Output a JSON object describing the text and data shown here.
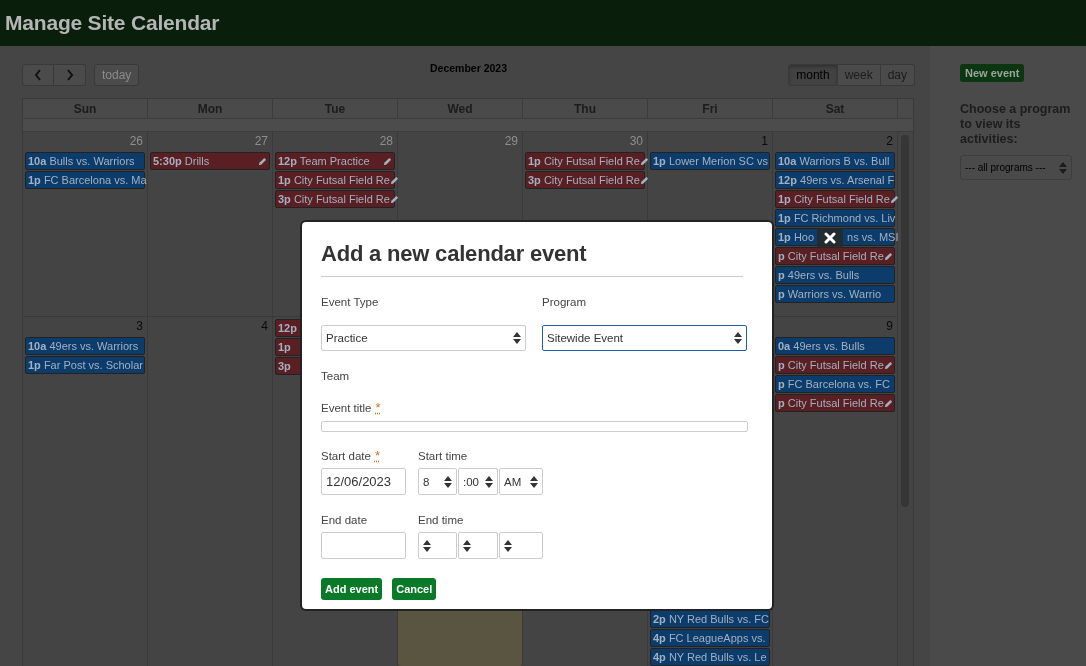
{
  "header": {
    "title": "Manage Site Calendar"
  },
  "toolbar": {
    "today_button": {
      "label": "today",
      "disabled": true
    },
    "title": "December 2023",
    "views": [
      {
        "label": "month",
        "selected": true
      },
      {
        "label": "week",
        "selected": false
      },
      {
        "label": "day",
        "selected": false
      }
    ]
  },
  "calendar": {
    "day_names": [
      "Sun",
      "Mon",
      "Tue",
      "Wed",
      "Thu",
      "Fri",
      "Sat"
    ],
    "weeks": [
      {
        "days": [
          {
            "date": "26",
            "other_month": true,
            "today": false,
            "events": [
              {
                "time": "10a",
                "title": "Bulls vs. Warriors",
                "color": "#0c3c6b",
                "editable": false
              },
              {
                "time": "1p",
                "title": "FC Barcelona vs. Ma",
                "color": "#0c3c6b"
              }
            ]
          },
          {
            "date": "27",
            "other_month": true,
            "today": false,
            "events": [
              {
                "time": "5:30p",
                "title": "Drills",
                "color": "#5a1f23",
                "editable": true
              }
            ]
          },
          {
            "date": "28",
            "other_month": true,
            "today": false,
            "events": [
              {
                "time": "12p",
                "title": "Team Practice",
                "color": "#5a1f23",
                "editable": true
              },
              {
                "time": "1p",
                "title": "City Futsal Field Re",
                "color": "#5a1f23",
                "editable": true
              },
              {
                "time": "3p",
                "title": "City Futsal Field Re",
                "color": "#5a1f23",
                "editable": true
              }
            ]
          },
          {
            "date": "29",
            "other_month": true,
            "today": false
          },
          {
            "date": "30",
            "other_month": true,
            "today": false,
            "events": [
              {
                "time": "1p",
                "title": "City Futsal Field Re",
                "color": "#5a1f23",
                "editable": true
              },
              {
                "time": "3p",
                "title": "City Futsal Field Re",
                "color": "#5a1f23",
                "editable": true
              }
            ]
          },
          {
            "date": "1",
            "other_month": false,
            "today": false,
            "events": [
              {
                "time": "1p",
                "title": "Lower Merion SC vs",
                "color": "#0c3c6b",
                "editable": false
              }
            ]
          },
          {
            "date": "2",
            "other_month": false,
            "today": false,
            "events": [
              {
                "time": "10a",
                "title": "Warriors B vs. Bull",
                "color": "#0c3c6b",
                "editable": false
              },
              {
                "time": "12p",
                "title": "49ers vs. Arsenal F",
                "color": "#0c3c6b",
                "editable": false
              },
              {
                "time": "1p",
                "title": "City Futsal Field Re",
                "color": "#5a1f23",
                "editable": true
              },
              {
                "time": "1p",
                "title": "FC Richmond vs. Liv",
                "color": "#0c3c6b"
              },
              {
                "time": "1p",
                "title": "Hoo",
                "title_continued": "ns vs. MSI",
                "color": "#0c3c6b"
              },
              {
                "time": "p",
                "title": "City Futsal Field Re",
                "color": "#5a1f23",
                "editable": true
              },
              {
                "time": "p",
                "title": "49ers vs. Bulls",
                "color": "#0c3c6b",
                "editable": false
              },
              {
                "time": "p",
                "title": "Warriors vs. Warrio",
                "color": "#0c3c6b",
                "editable": false
              }
            ]
          }
        ]
      },
      {
        "days": [
          {
            "date": "3",
            "other_month": false,
            "today": false,
            "events": [
              {
                "time": "10a",
                "title": "49ers vs. Warriors",
                "color": "#0c3c6b",
                "editable": false
              },
              {
                "time": "1p",
                "title": "Far Post vs. Scholar",
                "color": "#0c3c6b",
                "editable": false
              }
            ]
          },
          {
            "date": "4",
            "other_month": false,
            "today": false
          },
          {
            "today": false,
            "events": [
              {
                "time": "12p",
                "color": "#5a1f23"
              },
              {
                "time": "1p",
                "color": "#5a1f23"
              },
              {
                "time": "3p",
                "color": "#5a1f23"
              }
            ]
          },
          {
            "today": true
          },
          {
            "today": false
          },
          {
            "today": false,
            "events": [
              {
                "time": "2p",
                "title": "NY Red Bulls vs. FC",
                "color": "#0c3c6b",
                "editable": false
              },
              {
                "time": "4p",
                "title": "FC LeagueApps vs.",
                "color": "#0c3c6b",
                "editable": false
              },
              {
                "time": "4p",
                "title": "NY Red Bulls vs. Le",
                "color": "#0c3c6b",
                "editable": false
              }
            ]
          },
          {
            "date": "9",
            "other_month": false,
            "today": false,
            "events": [
              {
                "time": "0a",
                "title": "49ers vs. Bulls",
                "color": "#0c3c6b",
                "editable": false
              },
              {
                "time": "p",
                "title": "City Futsal Field Re",
                "color": "#5a1f23",
                "editable": true
              },
              {
                "time": "p",
                "title": "FC Barcelona vs. FC",
                "color": "#0c3c6b",
                "editable": false
              },
              {
                "time": "p",
                "title": "City Futsal Field Re",
                "color": "#5a1f23",
                "editable": true
              }
            ]
          }
        ]
      }
    ]
  },
  "dialog": {
    "title": "Add a new calendar event",
    "event_type": {
      "label": "Event Type",
      "value": "Practice",
      "focused": false
    },
    "program": {
      "label": "Program",
      "value": "Sitewide Event",
      "focused": true
    },
    "team": {
      "label": "Team"
    },
    "event_title": {
      "label": "Event title",
      "required_mark": "*"
    },
    "start_date": {
      "label": "Start date",
      "required_mark": "*",
      "value": "12/06/2023"
    },
    "start_time": {
      "label": "Start time",
      "hour": "8",
      "minute": ":00",
      "meridiem": "AM"
    },
    "end_date": {
      "label": "End date"
    },
    "end_time": {
      "label": "End time"
    },
    "buttons": [
      "Add event",
      "Cancel"
    ]
  },
  "sidebar": {
    "new_event_button": "New event",
    "program_filter": {
      "label": "Choose a program to view its activities:",
      "value": "--- all programs ---"
    }
  }
}
